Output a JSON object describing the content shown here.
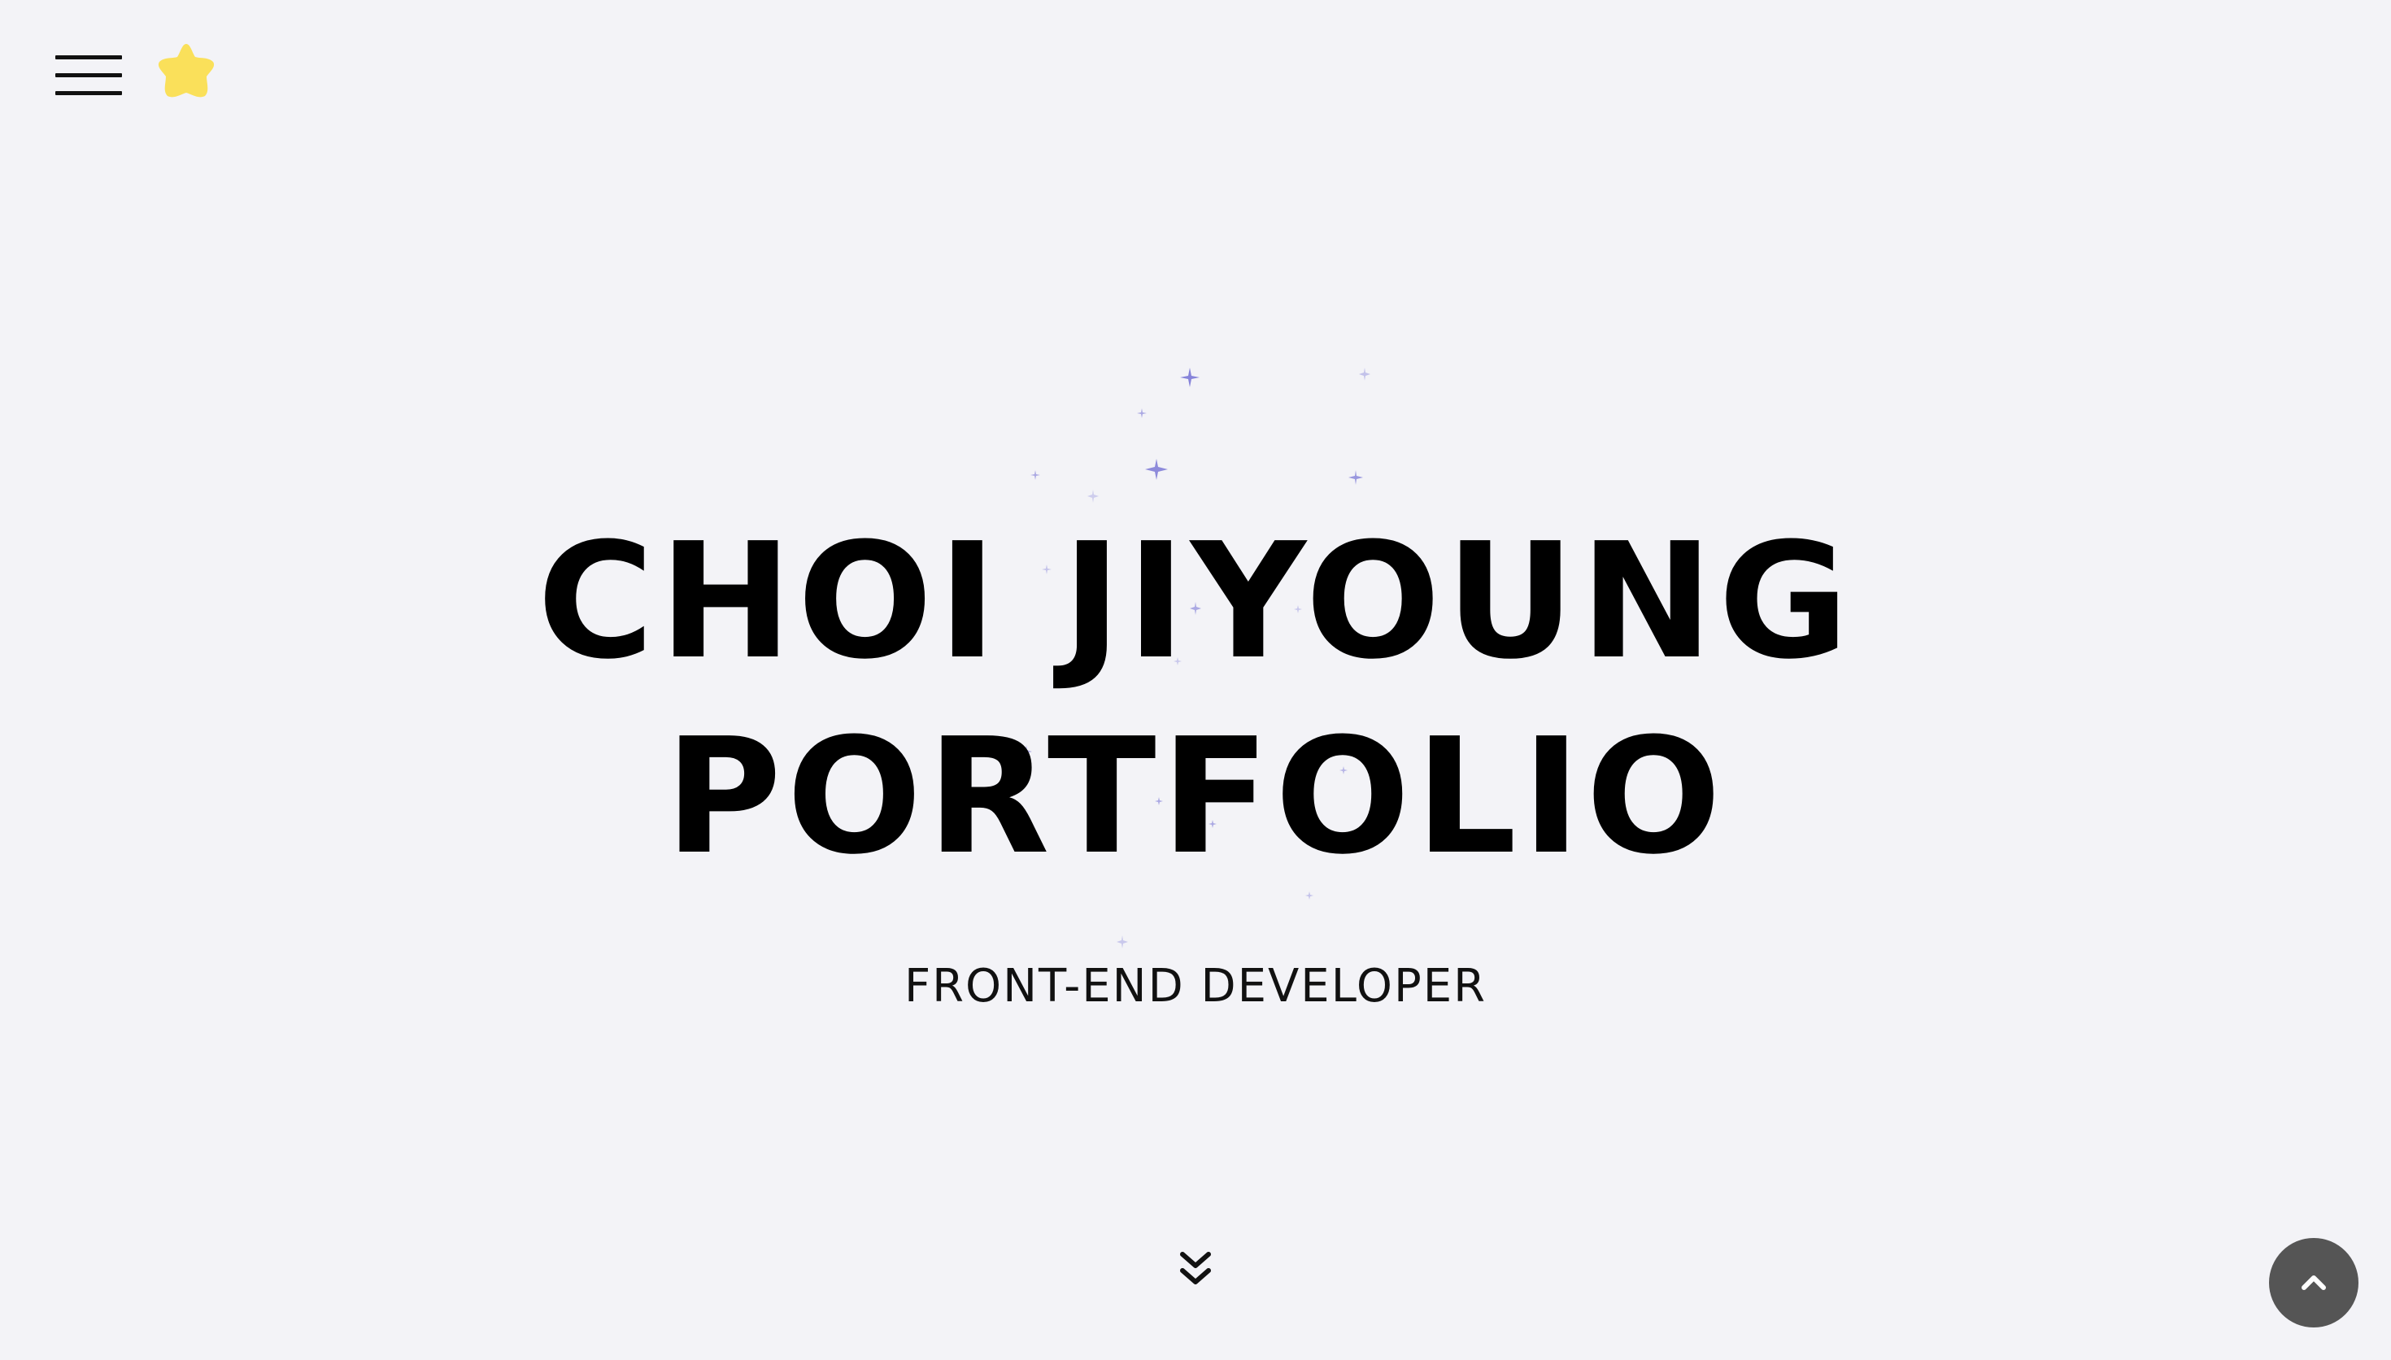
{
  "header": {
    "menu_icon": "hamburger-menu-icon",
    "logo_icon": "star-icon",
    "logo_color": "#fae05a"
  },
  "hero": {
    "title_line1": "CHOI JIYOUNG",
    "title_line2": "PORTFOLIO",
    "subtitle": "FRONT-END DEVELOPER",
    "sparkle_color": "#7b78d6"
  },
  "controls": {
    "scroll_down_icon": "double-chevron-down-icon",
    "scroll_top_icon": "chevron-up-icon",
    "scroll_top_color": "#555555"
  }
}
